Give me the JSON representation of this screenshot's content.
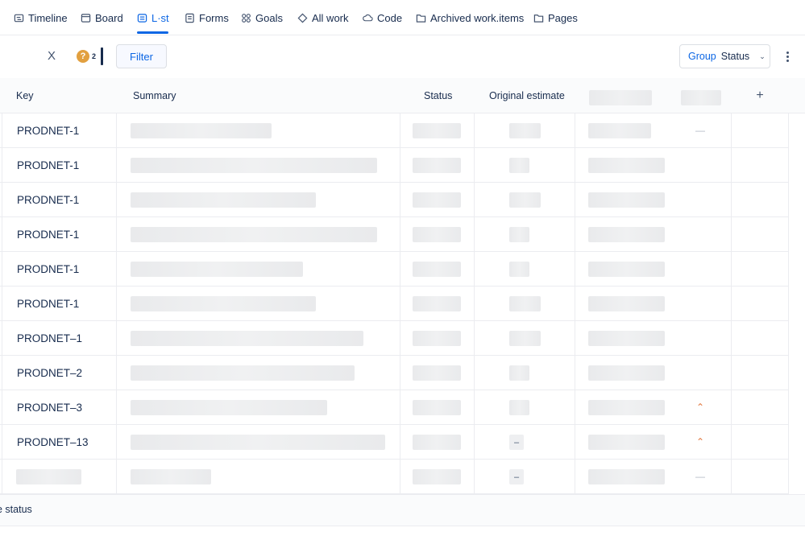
{
  "nav": {
    "items": [
      {
        "label": "Timeline",
        "icon": "timeline-icon"
      },
      {
        "label": "Board",
        "icon": "board-icon"
      },
      {
        "label": "L·st",
        "icon": "list-icon",
        "active": true
      },
      {
        "label": "Forms",
        "icon": "forms-icon"
      },
      {
        "label": "Goals",
        "icon": "goals-icon"
      },
      {
        "label": "All work",
        "icon": "all-work-icon"
      },
      {
        "label": "Code",
        "icon": "code-icon"
      },
      {
        "label": "Archived work.items",
        "icon": "archive-icon"
      },
      {
        "label": "Pages",
        "icon": "pages-icon"
      }
    ]
  },
  "toolbar": {
    "clear_label": "X",
    "help_glyph": "?",
    "avatar_count": "2",
    "filter_label": "Filter",
    "group_label": "Group",
    "group_value": "Status"
  },
  "table": {
    "headers": {
      "key": "Key",
      "summary": "Summary",
      "status": "Status",
      "original_estimate": "Original estimate",
      "add_column": "+"
    },
    "rows": [
      {
        "key": "PRODNET-1",
        "estimate": "",
        "priority": "low"
      },
      {
        "key": "PRODNET-1",
        "estimate": "",
        "priority": ""
      },
      {
        "key": "PRODNET-1",
        "estimate": "",
        "priority": ""
      },
      {
        "key": "PRODNET-1",
        "estimate": "",
        "priority": ""
      },
      {
        "key": "PRODNET-1",
        "estimate": "",
        "priority": ""
      },
      {
        "key": "PRODNET-1",
        "estimate": "",
        "priority": ""
      },
      {
        "key": "PRODNET–1",
        "estimate": "",
        "priority": ""
      },
      {
        "key": "PRODNET–2",
        "estimate": "",
        "priority": ""
      },
      {
        "key": "PRODNET–3",
        "estimate": "",
        "priority": "high"
      },
      {
        "key": "PRODNET–13",
        "estimate": "–",
        "priority": "high"
      },
      {
        "key": "",
        "estimate": "–",
        "priority": "low"
      }
    ]
  },
  "footer": {
    "text": "e status"
  },
  "colors": {
    "accent": "#0c66e4",
    "priority_high": "#e2783f",
    "priority_low": "#b3b9c4",
    "help_badge": "#e2a03f"
  }
}
